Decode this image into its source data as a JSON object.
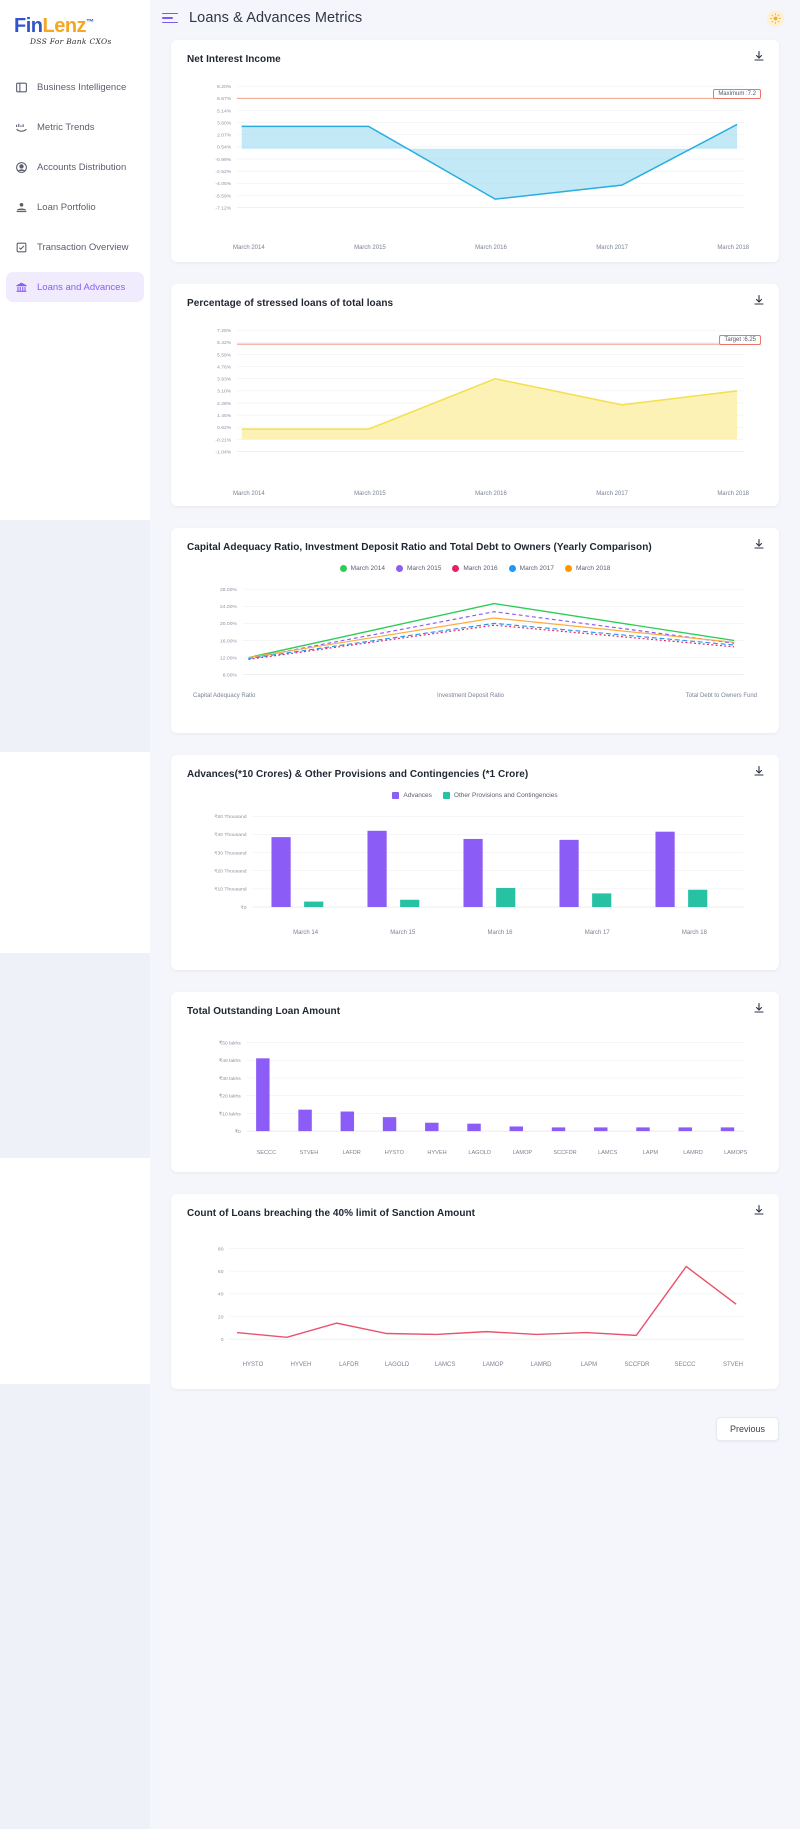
{
  "brand": {
    "part1": "Fin",
    "part2": "Lenz",
    "tm": "™",
    "tagline": "DSS For Bank CXOs"
  },
  "sidebar": {
    "items": [
      {
        "label": "Business Intelligence",
        "icon": "layout-icon",
        "active": false
      },
      {
        "label": "Metric Trends",
        "icon": "trend-icon",
        "active": false
      },
      {
        "label": "Accounts Distribution",
        "icon": "user-circle-icon",
        "active": false
      },
      {
        "label": "Loan Portfolio",
        "icon": "hand-coin-icon",
        "active": false
      },
      {
        "label": "Transaction Overview",
        "icon": "checklist-icon",
        "active": false
      },
      {
        "label": "Loans and Advances",
        "icon": "bank-icon",
        "active": true
      }
    ]
  },
  "header": {
    "title": "Loans & Advances Metrics",
    "menu_icon": "hamburger-icon",
    "theme_icon": "sun-icon"
  },
  "footer": {
    "previous_label": "Previous"
  },
  "colors": {
    "accent": "#8b5cf6",
    "brand_blue": "#3355c9",
    "brand_orange": "#f5a623",
    "net_interest_line": "#29aee0",
    "net_interest_fill": "#a8e2f5",
    "stressed_line": "#f5e35a",
    "stressed_fill": "#fcf5b8",
    "threshold_line": "#f08c7a",
    "advances": "#8b5cf6",
    "provisions": "#26c2a3",
    "outstanding": "#8b5cf6",
    "breach_line": "#e8536d"
  },
  "charts": [
    {
      "id": "net-interest-income",
      "title": "Net Interest Income",
      "download_icon": "download-icon",
      "chart_data": {
        "type": "area",
        "title": "Net Interest Income",
        "categories": [
          "March 2014",
          "March 2015",
          "March 2016",
          "March 2017",
          "March 2018"
        ],
        "values": [
          3.2,
          3.2,
          -5.9,
          -4.2,
          3.0
        ],
        "ylabel": "",
        "xlabel": "",
        "ytick_labels": [
          "8.20%",
          "6.67%",
          "5.14%",
          "3.60%",
          "2.07%",
          "0.54%",
          "-0.99%",
          "-2.52%",
          "-4.05%",
          "-5.59%",
          "-7.12%"
        ],
        "ylim": [
          -7.12,
          8.2
        ],
        "grid": true,
        "annotation": {
          "label": "Maximum :7.2",
          "value": 6.67,
          "color": "#f08c7a"
        }
      }
    },
    {
      "id": "percentage-stressed-loans",
      "title": "Percentage of stressed loans of total loans",
      "download_icon": "download-icon",
      "chart_data": {
        "type": "area",
        "title": "Percentage of stressed loans of total loans",
        "categories": [
          "March 2014",
          "March 2015",
          "March 2016",
          "March 2017",
          "March 2018"
        ],
        "values": [
          0.62,
          0.62,
          3.93,
          2.28,
          3.1
        ],
        "ylabel": "",
        "xlabel": "",
        "ytick_labels": [
          "7.25%",
          "6.42%",
          "5.59%",
          "4.76%",
          "3.93%",
          "3.10%",
          "2.28%",
          "1.45%",
          "0.62%",
          "-0.21%",
          "-1.04%"
        ],
        "ylim": [
          -1.04,
          7.25
        ],
        "grid": true,
        "annotation": {
          "label": "Target :6.25",
          "value": 6.25,
          "color": "#f08c7a"
        }
      }
    },
    {
      "id": "capital-adequacy-comparison",
      "title": "Capital Adequacy Ratio, Investment Deposit Ratio and Total Debt to Owners (Yearly Comparison)",
      "download_icon": "download-icon",
      "chart_data": {
        "type": "line",
        "title": "Capital Adequacy Ratio, Investment Deposit Ratio and Total Debt to Owners (Yearly Comparison)",
        "categories": [
          "Capital Adequacy Ratio",
          "Investment Deposit Ratio",
          "Total Debt to Owners Fund"
        ],
        "ytick_labels": [
          "28.00%",
          "24.00%",
          "20.00%",
          "16.00%",
          "12.00%",
          "8.00%"
        ],
        "ylim": [
          8,
          28
        ],
        "grid": true,
        "legend_position": "top",
        "series": [
          {
            "name": "March 2014",
            "color": "#2ecc55",
            "values": [
              12.4,
              24.6,
              16.0
            ]
          },
          {
            "name": "March 2015",
            "color": "#8b5cf6",
            "values": [
              12.2,
              22.8,
              15.4
            ]
          },
          {
            "name": "March 2016",
            "color": "#e91e63",
            "values": [
              12.0,
              19.6,
              14.6
            ]
          },
          {
            "name": "March 2017",
            "color": "#2196f3",
            "values": [
              12.3,
              20.0,
              15.0
            ]
          },
          {
            "name": "March 2018",
            "color": "#ff9800",
            "values": [
              12.5,
              21.2,
              15.8
            ]
          }
        ]
      }
    },
    {
      "id": "advances-provisions",
      "title": "Advances(*10 Crores) & Other Provisions and Contingencies (*1 Crore)",
      "download_icon": "download-icon",
      "chart_data": {
        "type": "bar",
        "title": "Advances(*10 Crores) & Other Provisions and Contingencies (*1 Crore)",
        "categories": [
          "March 14",
          "March 15",
          "March 16",
          "March 17",
          "March 18"
        ],
        "ytick_labels": [
          "₹50 Thousand",
          "₹40 Thousand",
          "₹30 Thousand",
          "₹20 Thousand",
          "₹10 Thousand",
          "₹0"
        ],
        "ylim": [
          0,
          50000
        ],
        "grid": true,
        "legend_position": "top",
        "series": [
          {
            "name": "Advances",
            "color": "#8b5cf6",
            "values": [
              38500,
              42000,
              37500,
              37000,
              41500
            ]
          },
          {
            "name": "Other Provisions and Contingencies",
            "color": "#26c2a3",
            "values": [
              1600,
              2200,
              10500,
              7500,
              9500
            ]
          }
        ]
      }
    },
    {
      "id": "total-outstanding-loan-amount",
      "title": "Total Outstanding Loan Amount",
      "download_icon": "download-icon",
      "chart_data": {
        "type": "bar",
        "title": "Total Outstanding Loan Amount",
        "categories": [
          "SECCC",
          "STVEH",
          "LAFDR",
          "HYSTO",
          "HYVEH",
          "LAGOLD",
          "LAMOP",
          "SCCFDR",
          "LAMCS",
          "LAPM",
          "LAMRD",
          "LAMOPS"
        ],
        "ytick_labels": [
          "₹50 lakhs",
          "₹40 lakhs",
          "₹30 lakhs",
          "₹20 lakhs",
          "₹10 lakhs",
          "₹0"
        ],
        "ylim": [
          0,
          50
        ],
        "grid": true,
        "values": [
          41,
          12,
          11,
          8,
          5,
          4.5,
          3,
          2,
          2,
          2,
          2,
          2
        ],
        "color": "#8b5cf6"
      }
    },
    {
      "id": "loans-breaching-limit",
      "title": "Count of Loans breaching the 40% limit of Sanction Amount",
      "download_icon": "download-icon",
      "chart_data": {
        "type": "line",
        "title": "Count of Loans breaching the 40% limit of Sanction Amount",
        "categories": [
          "HYSTO",
          "HYVEH",
          "LAFDR",
          "LAGOLD",
          "LAMCS",
          "LAMOP",
          "LAMRD",
          "LAPM",
          "SCCFDR",
          "SECCC",
          "STVEH"
        ],
        "ytick_labels": [
          "80",
          "60",
          "40",
          "20",
          "0"
        ],
        "ylim": [
          0,
          80
        ],
        "grid": true,
        "values": [
          6,
          2,
          14,
          5,
          4,
          7,
          4,
          6,
          3,
          64,
          31
        ],
        "color": "#e8536d"
      }
    }
  ]
}
